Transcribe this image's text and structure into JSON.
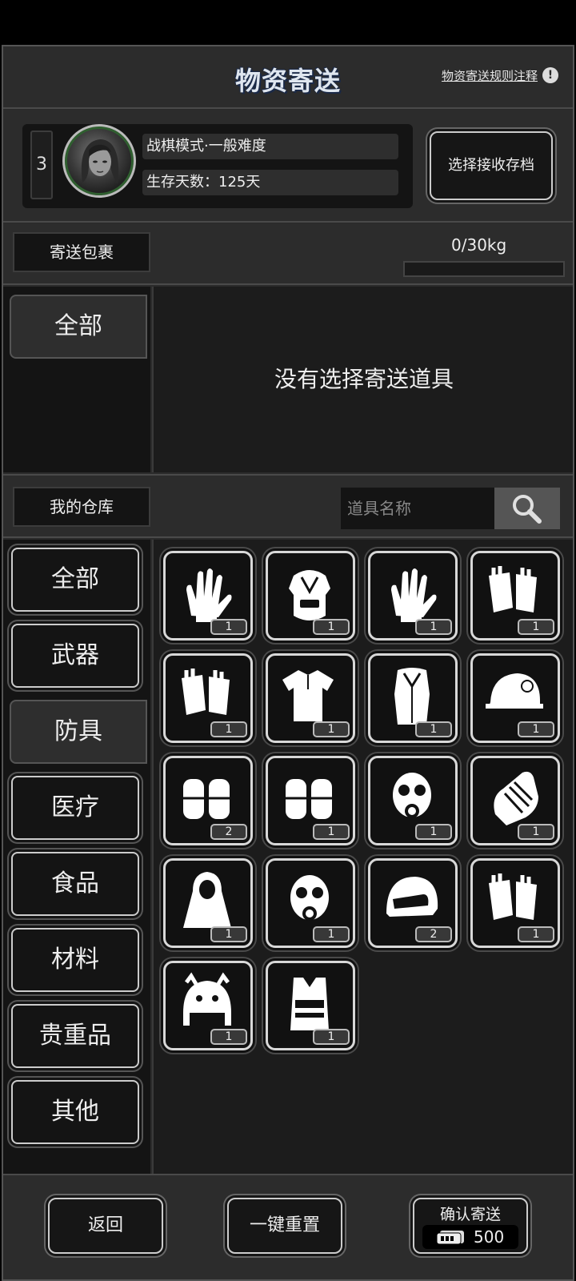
{
  "header": {
    "title": "物资寄送",
    "rules_link": "物资寄送规则注释",
    "info_icon": "!"
  },
  "profile": {
    "slot_number": "3",
    "mode": "战棋模式·一般难度",
    "survival_days": "生存天数：125天",
    "select_save_button": "选择接收存档"
  },
  "package": {
    "label": "寄送包裹",
    "weight": "0/30kg",
    "weight_fraction": 0,
    "category_tab": "全部",
    "empty_message": "没有选择寄送道具"
  },
  "warehouse": {
    "label": "我的仓库",
    "search_placeholder": "道具名称",
    "categories": [
      {
        "label": "全部",
        "active": false
      },
      {
        "label": "武器",
        "active": false
      },
      {
        "label": "防具",
        "active": true
      },
      {
        "label": "医疗",
        "active": false
      },
      {
        "label": "食品",
        "active": false
      },
      {
        "label": "材料",
        "active": false
      },
      {
        "label": "贵重品",
        "active": false
      },
      {
        "label": "其他",
        "active": false
      }
    ],
    "items": [
      {
        "icon": "tactical-gloves-icon",
        "qty": "1"
      },
      {
        "icon": "body-armor-icon",
        "qty": "1"
      },
      {
        "icon": "glove-icon",
        "qty": "1"
      },
      {
        "icon": "fingerless-gloves-icon",
        "qty": "1"
      },
      {
        "icon": "fingerless-mitts-icon",
        "qty": "1"
      },
      {
        "icon": "shirt-icon",
        "qty": "1"
      },
      {
        "icon": "fur-coat-icon",
        "qty": "1"
      },
      {
        "icon": "army-helmet-icon",
        "qty": "1"
      },
      {
        "icon": "knee-pads-icon",
        "qty": "2"
      },
      {
        "icon": "knee-pads-alt-icon",
        "qty": "1"
      },
      {
        "icon": "gas-mask-icon",
        "qty": "1"
      },
      {
        "icon": "armored-gauntlet-icon",
        "qty": "1"
      },
      {
        "icon": "hooded-cloak-icon",
        "qty": "1"
      },
      {
        "icon": "gas-mask-alt-icon",
        "qty": "1"
      },
      {
        "icon": "motorcycle-helmet-icon",
        "qty": "2"
      },
      {
        "icon": "fingerless-gloves-alt-icon",
        "qty": "1"
      },
      {
        "icon": "tiger-hat-icon",
        "qty": "1"
      },
      {
        "icon": "tactical-vest-icon",
        "qty": "1"
      }
    ]
  },
  "footer": {
    "back_button": "返回",
    "reset_button": "一键重置",
    "confirm_button": "确认寄送",
    "cost_icon": "ticket-icon",
    "cost": "500"
  }
}
